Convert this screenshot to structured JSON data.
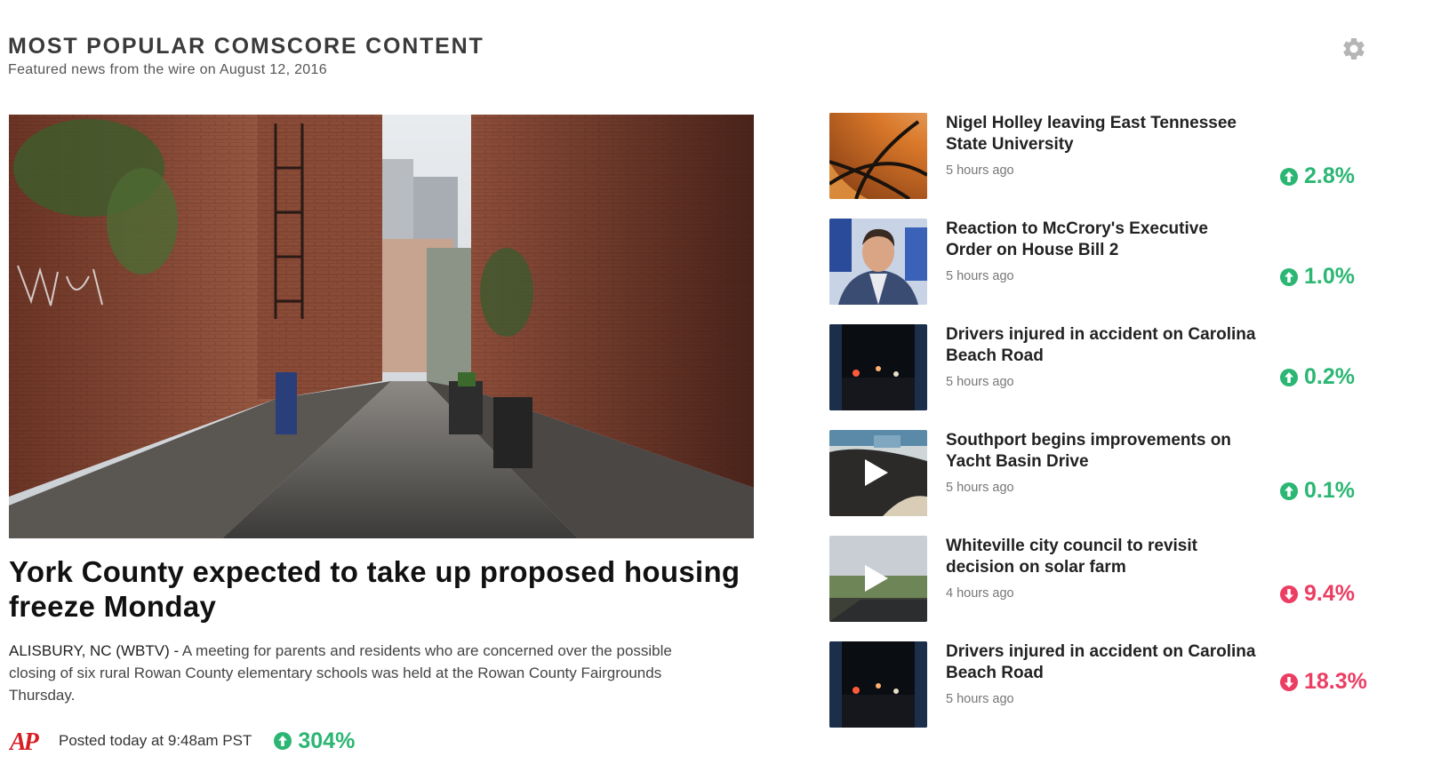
{
  "header": {
    "title": "MOST POPULAR COMSCORE CONTENT",
    "subtitle": "Featured news from the wire on August 12, 2016"
  },
  "settings_icon": "gear-icon",
  "featured": {
    "headline": "York County expected to take up proposed housing freeze Monday",
    "dateline": "ALISBURY, NC (WBTV) - ",
    "summary": "A meeting for parents and residents who are concerned over the possible closing of six rural Rowan County elementary schools was held at the Rowan County Fairgrounds Thursday.",
    "source_logo": "ap-logo",
    "source_logo_text": "AP",
    "posted": "Posted today at 9:48am PST",
    "change": "304%",
    "direction": "up"
  },
  "items": [
    {
      "title": "Nigel Holley leaving East Tennessee State University",
      "time": "5 hours ago",
      "change": "2.8%",
      "direction": "up",
      "thumb": "basketball-thumbnail"
    },
    {
      "title": "Reaction to McCrory's Executive Order on House Bill 2",
      "time": "5 hours ago",
      "change": "1.0%",
      "direction": "up",
      "thumb": "speaker-thumbnail"
    },
    {
      "title": "Drivers injured in accident on Carolina Beach Road",
      "time": "5 hours ago",
      "change": "0.2%",
      "direction": "up",
      "thumb": "night-road-thumbnail"
    },
    {
      "title": "Southport begins improvements on Yacht Basin Drive",
      "time": "5 hours ago",
      "change": "0.1%",
      "direction": "up",
      "thumb": "gravel-video-thumbnail"
    },
    {
      "title": "Whiteville city council to revisit decision on solar farm",
      "time": "4 hours ago",
      "change": "9.4%",
      "direction": "down",
      "thumb": "field-video-thumbnail"
    },
    {
      "title": "Drivers injured in accident on Carolina Beach Road",
      "time": "5 hours ago",
      "change": "18.3%",
      "direction": "down",
      "thumb": "night-road-thumbnail"
    }
  ],
  "colors": {
    "up": "#2bb673",
    "down": "#ec3d63"
  }
}
